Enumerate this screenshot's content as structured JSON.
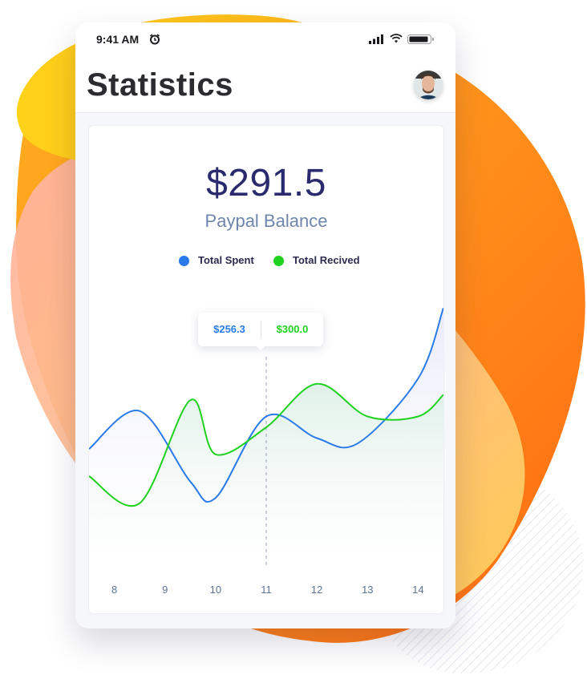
{
  "status_bar": {
    "time": "9:41 AM",
    "icons": [
      "alarm-icon",
      "signal-icon",
      "wifi-icon",
      "battery-icon"
    ]
  },
  "header": {
    "title": "Statistics",
    "avatar": "user-avatar"
  },
  "balance": {
    "amount": "$291.5",
    "label": "Paypal Balance"
  },
  "legend": [
    {
      "label": "Total Spent",
      "color": "#2a7bea"
    },
    {
      "label": "Total Recived",
      "color": "#1fd21f"
    }
  ],
  "tooltip": {
    "spent": "$256.3",
    "received": "$300.0"
  },
  "colors": {
    "accent_blue": "#2a7bea",
    "accent_green": "#1fd21f",
    "title": "#2a2a6e",
    "subtitle": "#6e86ad"
  },
  "chart_data": {
    "type": "line",
    "x": [
      8,
      9,
      10,
      11,
      12,
      13,
      14
    ],
    "tick_labels": [
      "8",
      "9",
      "10",
      "11",
      "12",
      "13",
      "14"
    ],
    "series": [
      {
        "name": "Total Spent",
        "color": "#2a7bea",
        "points": [
          [
            7.5,
            170
          ],
          [
            8.5,
            205
          ],
          [
            9.5,
            140
          ],
          [
            10,
            125
          ],
          [
            11,
            200
          ],
          [
            12,
            180
          ],
          [
            12.8,
            175
          ],
          [
            14,
            235
          ],
          [
            14.5,
            300
          ]
        ]
      },
      {
        "name": "Total Recived",
        "color": "#1fd21f",
        "points": [
          [
            7.5,
            145
          ],
          [
            8.5,
            120
          ],
          [
            9.5,
            215
          ],
          [
            10,
            165
          ],
          [
            11,
            190
          ],
          [
            12,
            230
          ],
          [
            13,
            200
          ],
          [
            14,
            200
          ],
          [
            14.5,
            220
          ]
        ]
      }
    ],
    "xlim": [
      7.5,
      14.5
    ],
    "ylim": [
      60,
      320
    ],
    "highlight_x": 11
  }
}
